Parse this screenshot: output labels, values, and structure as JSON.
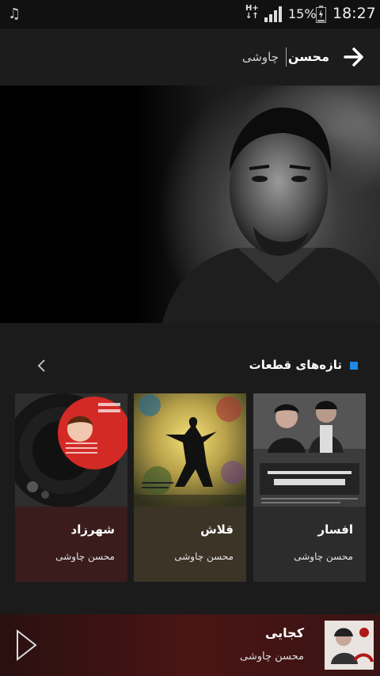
{
  "status_bar": {
    "network": "H+",
    "battery_percent": "15%",
    "time": "18:27",
    "icons": [
      "music-note-icon",
      "signal-icon",
      "battery-icon"
    ]
  },
  "header": {
    "title_first": "محسن",
    "title_last": "چاوشی",
    "back_icon": "arrow-right-icon"
  },
  "section": {
    "title": "تازه‌های قطعات",
    "more_icon": "chevron-left-icon",
    "accent": "#1e88e5"
  },
  "albums": [
    {
      "title": "شهرزاد",
      "artist": "محسن چاوشی",
      "cover_text": "شهرزاد",
      "color": "#3a1c1c"
    },
    {
      "title": "قلاش",
      "artist": "محسن چاوشی",
      "cover_text": "قلاش",
      "color": "#3c3426"
    },
    {
      "title": "افسار",
      "artist": "محسن چاوشی",
      "cover_text": "افسار",
      "color": "#2c2c2c"
    }
  ],
  "player": {
    "song": "کجایی",
    "artist": "محسن چاوشی",
    "play_icon": "play-icon"
  }
}
